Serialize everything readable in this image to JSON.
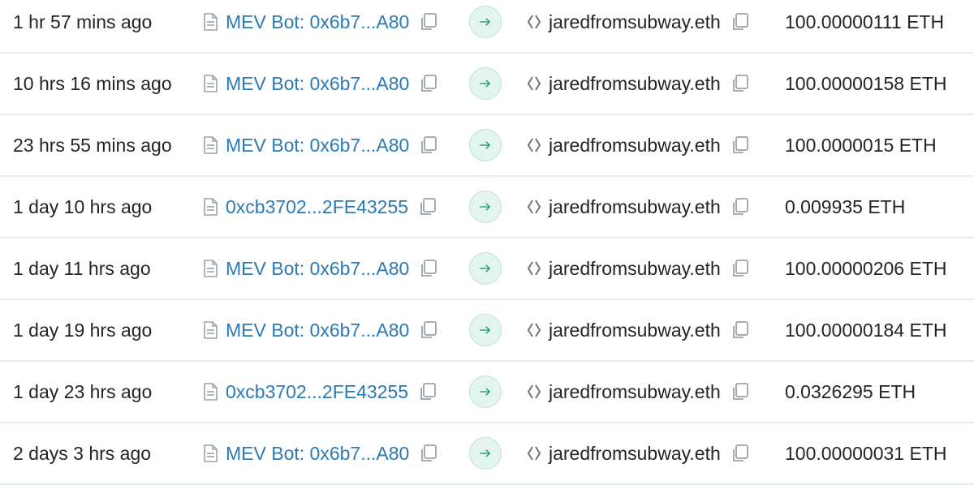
{
  "transactions": [
    {
      "age": "1 hr 57 mins ago",
      "from": "MEV Bot: 0x6b7...A80",
      "to": "jaredfromsubway.eth",
      "value": "100.00000111 ETH"
    },
    {
      "age": "10 hrs 16 mins ago",
      "from": "MEV Bot: 0x6b7...A80",
      "to": "jaredfromsubway.eth",
      "value": "100.00000158 ETH"
    },
    {
      "age": "23 hrs 55 mins ago",
      "from": "MEV Bot: 0x6b7...A80",
      "to": "jaredfromsubway.eth",
      "value": "100.0000015 ETH"
    },
    {
      "age": "1 day 10 hrs ago",
      "from": "0xcb3702...2FE43255",
      "to": "jaredfromsubway.eth",
      "value": "0.009935 ETH"
    },
    {
      "age": "1 day 11 hrs ago",
      "from": "MEV Bot: 0x6b7...A80",
      "to": "jaredfromsubway.eth",
      "value": "100.00000206 ETH"
    },
    {
      "age": "1 day 19 hrs ago",
      "from": "MEV Bot: 0x6b7...A80",
      "to": "jaredfromsubway.eth",
      "value": "100.00000184 ETH"
    },
    {
      "age": "1 day 23 hrs ago",
      "from": "0xcb3702...2FE43255",
      "to": "jaredfromsubway.eth",
      "value": "0.0326295 ETH"
    },
    {
      "age": "2 days 3 hrs ago",
      "from": "MEV Bot: 0x6b7...A80",
      "to": "jaredfromsubway.eth",
      "value": "100.00000031 ETH"
    }
  ],
  "icons": {
    "from_icon": "document-icon",
    "copy_icon": "copy-icon",
    "direction_icon": "arrow-right-icon",
    "to_icon": "contract-icon"
  },
  "colors": {
    "link": "#2a7ab8",
    "text": "#212529",
    "arrow_badge_bg": "#e4f5ef",
    "arrow_color": "#1d9b74",
    "divider": "#e9ecef",
    "icon_gray": "#9aa3ab"
  }
}
